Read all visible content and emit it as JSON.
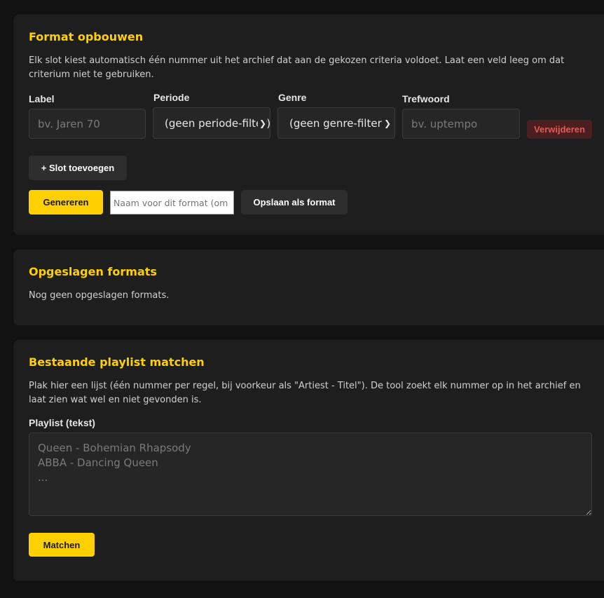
{
  "builder": {
    "title": "Format opbouwen",
    "description": "Elk slot kiest automatisch één nummer uit het archief dat aan de gekozen criteria voldoet. Laat een veld leeg om dat criterium niet te gebruiken.",
    "slot": {
      "label_label": "Label",
      "label_placeholder": "bv. Jaren 70",
      "period_label": "Periode",
      "period_value": "(geen periode-filter)",
      "genre_label": "Genre",
      "genre_value": "(geen genre-filter)",
      "keyword_label": "Trefwoord",
      "keyword_placeholder": "bv. uptempo",
      "remove_label": "Verwijderen"
    },
    "add_slot_label": "+ Slot toevoegen",
    "generate_label": "Genereren",
    "format_name_placeholder": "Naam voor dit format (om op te slaan)",
    "save_label": "Opslaan als format"
  },
  "saved": {
    "title": "Opgeslagen formats",
    "empty_text": "Nog geen opgeslagen formats."
  },
  "matcher": {
    "title": "Bestaande playlist matchen",
    "description": "Plak hier een lijst (één nummer per regel, bij voorkeur als \"Artiest - Titel\"). De tool zoekt elk nummer op in het archief en laat zien wat wel en niet gevonden is.",
    "playlist_label": "Playlist (tekst)",
    "playlist_placeholder": "Queen - Bohemian Rhapsody\nABBA - Dancing Queen\n...",
    "match_label": "Matchen"
  },
  "colors": {
    "accent": "#ffd000",
    "danger": "#e05a5a"
  }
}
